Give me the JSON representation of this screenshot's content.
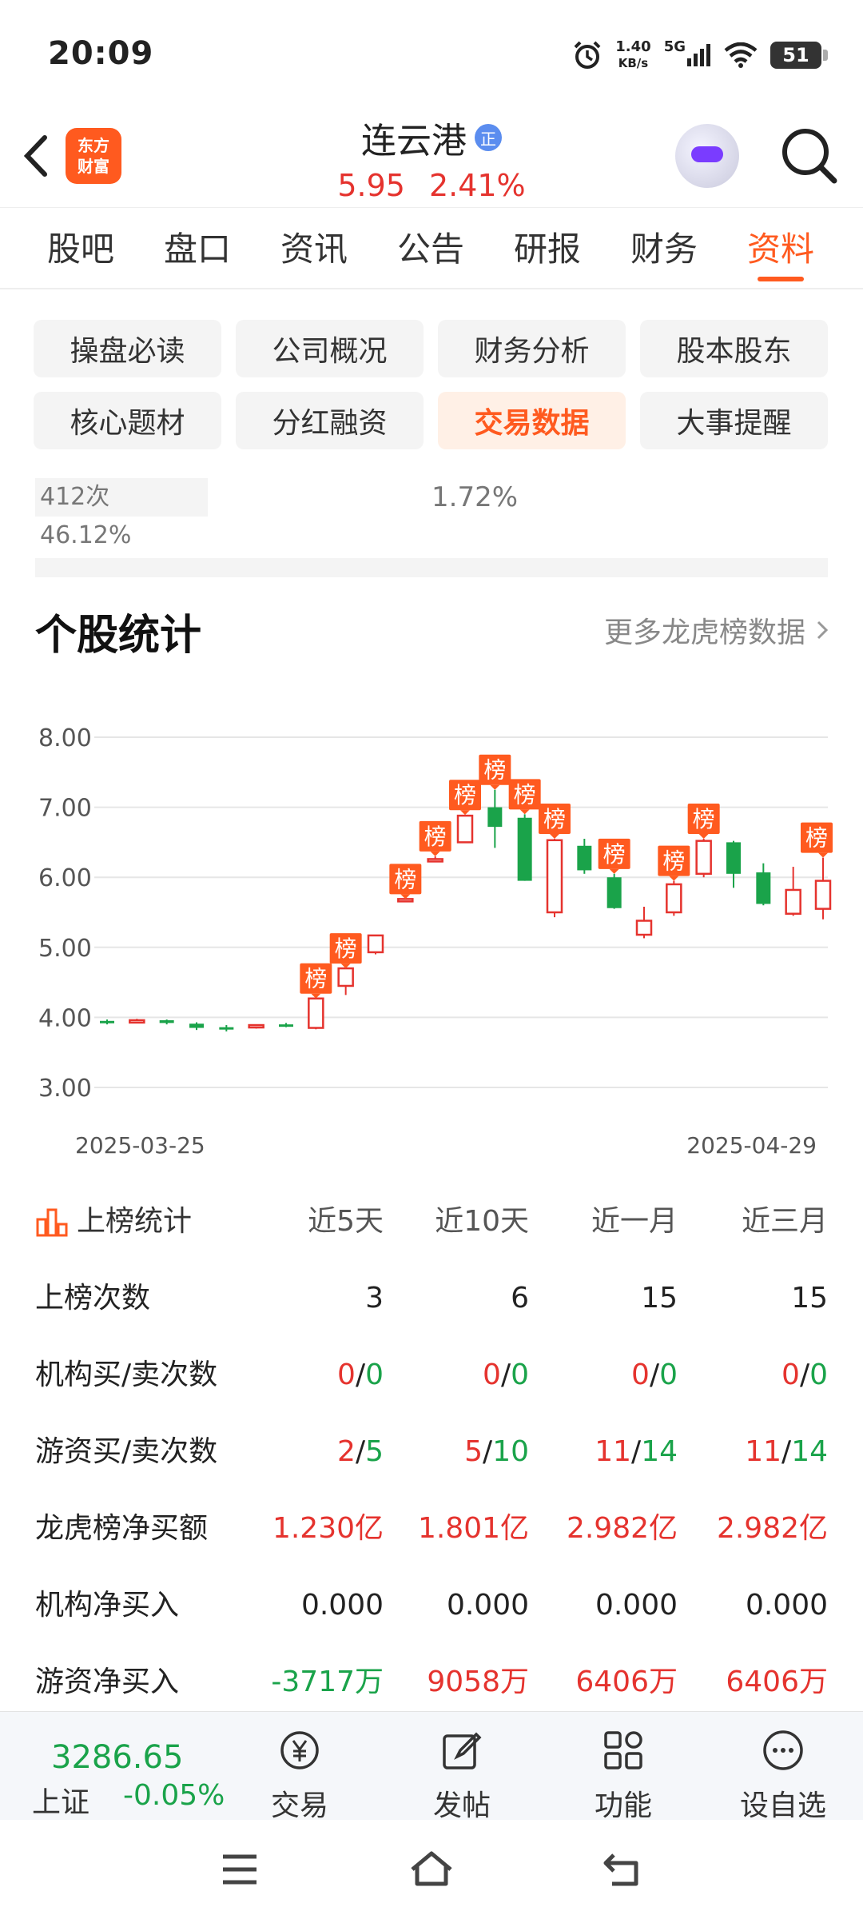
{
  "status_bar": {
    "time": "20:09",
    "net_speed_value": "1.40",
    "net_speed_unit": "KB/s",
    "network": "5G",
    "battery": "51"
  },
  "header": {
    "logo_text_1": "东方",
    "logo_text_2": "财富",
    "stock_name": "连云港",
    "badge": "正",
    "price": "5.95",
    "change_pct": "2.41%"
  },
  "tabs": [
    {
      "label": "股吧"
    },
    {
      "label": "盘口"
    },
    {
      "label": "资讯"
    },
    {
      "label": "公告"
    },
    {
      "label": "研报"
    },
    {
      "label": "财务"
    },
    {
      "label": "资料",
      "active": true
    }
  ],
  "sub_tabs": [
    {
      "label": "操盘必读"
    },
    {
      "label": "公司概况"
    },
    {
      "label": "财务分析"
    },
    {
      "label": "股本股东"
    },
    {
      "label": "核心题材"
    },
    {
      "label": "分红融资"
    },
    {
      "label": "交易数据",
      "active": true
    },
    {
      "label": "大事提醒"
    }
  ],
  "snippet": {
    "left": "412次 46.12%",
    "mid": "1.72%"
  },
  "section": {
    "title": "个股统计",
    "more_link": "更多龙虎榜数据"
  },
  "chart_data": {
    "type": "candlestick",
    "x_start_label": "2025-03-25",
    "x_end_label": "2025-04-29",
    "yticks": [
      "8.00",
      "7.00",
      "6.00",
      "5.00",
      "4.00",
      "3.00"
    ],
    "ylim": [
      3.0,
      8.0
    ],
    "marker_text": "榜",
    "up_color": "#e5332e",
    "down_color": "#1aa34a",
    "marker_color": "#ff5a1f",
    "candles": [
      {
        "o": 3.95,
        "c": 3.92,
        "h": 3.97,
        "l": 3.9,
        "m": false
      },
      {
        "o": 3.94,
        "c": 3.96,
        "h": 3.98,
        "l": 3.92,
        "m": false
      },
      {
        "o": 3.96,
        "c": 3.92,
        "h": 3.97,
        "l": 3.9,
        "m": false
      },
      {
        "o": 3.91,
        "c": 3.85,
        "h": 3.93,
        "l": 3.82,
        "m": false
      },
      {
        "o": 3.86,
        "c": 3.83,
        "h": 3.89,
        "l": 3.8,
        "m": false
      },
      {
        "o": 3.86,
        "c": 3.89,
        "h": 3.9,
        "l": 3.84,
        "m": false
      },
      {
        "o": 3.9,
        "c": 3.88,
        "h": 3.92,
        "l": 3.86,
        "m": false
      },
      {
        "o": 3.85,
        "c": 4.27,
        "h": 4.27,
        "l": 3.83,
        "m": true
      },
      {
        "o": 4.45,
        "c": 4.7,
        "h": 4.7,
        "l": 4.32,
        "m": true
      },
      {
        "o": 4.93,
        "c": 5.17,
        "h": 5.17,
        "l": 4.9,
        "m": false
      },
      {
        "o": 5.69,
        "c": 5.69,
        "h": 5.69,
        "l": 5.65,
        "m": true
      },
      {
        "o": 6.26,
        "c": 6.26,
        "h": 6.3,
        "l": 6.24,
        "m": true
      },
      {
        "o": 6.5,
        "c": 6.88,
        "h": 6.89,
        "l": 6.5,
        "m": true
      },
      {
        "o": 7.0,
        "c": 6.72,
        "h": 7.25,
        "l": 6.42,
        "m": true
      },
      {
        "o": 6.85,
        "c": 5.95,
        "h": 6.9,
        "l": 5.95,
        "m": true
      },
      {
        "o": 5.5,
        "c": 6.53,
        "h": 6.55,
        "l": 5.43,
        "m": true
      },
      {
        "o": 6.45,
        "c": 6.1,
        "h": 6.55,
        "l": 6.05,
        "m": false
      },
      {
        "o": 6.0,
        "c": 5.56,
        "h": 6.05,
        "l": 5.55,
        "m": true
      },
      {
        "o": 5.18,
        "c": 5.38,
        "h": 5.58,
        "l": 5.13,
        "m": false
      },
      {
        "o": 5.5,
        "c": 5.9,
        "h": 5.95,
        "l": 5.45,
        "m": true
      },
      {
        "o": 6.05,
        "c": 6.52,
        "h": 6.55,
        "l": 6.0,
        "m": true
      },
      {
        "o": 6.5,
        "c": 6.05,
        "h": 6.52,
        "l": 5.85,
        "m": false
      },
      {
        "o": 6.07,
        "c": 5.62,
        "h": 6.2,
        "l": 5.6,
        "m": false
      },
      {
        "o": 5.48,
        "c": 5.82,
        "h": 6.15,
        "l": 5.45,
        "m": false
      },
      {
        "o": 5.55,
        "c": 5.95,
        "h": 6.28,
        "l": 5.4,
        "m": true
      }
    ]
  },
  "stats": {
    "header": {
      "label": "上榜统计",
      "cols": [
        "近5天",
        "近10天",
        "近一月",
        "近三月"
      ]
    },
    "rows": [
      {
        "label": "上榜次数",
        "type": "plain",
        "values": [
          "3",
          "6",
          "15",
          "15"
        ]
      },
      {
        "label": "机构买/卖次数",
        "type": "split",
        "values": [
          [
            "0",
            "0"
          ],
          [
            "0",
            "0"
          ],
          [
            "0",
            "0"
          ],
          [
            "0",
            "0"
          ]
        ]
      },
      {
        "label": "游资买/卖次数",
        "type": "split",
        "values": [
          [
            "2",
            "5"
          ],
          [
            "5",
            "10"
          ],
          [
            "11",
            "14"
          ],
          [
            "11",
            "14"
          ]
        ]
      },
      {
        "label": "龙虎榜净买额",
        "type": "colored",
        "values": [
          [
            "1.230亿",
            "red"
          ],
          [
            "1.801亿",
            "red"
          ],
          [
            "2.982亿",
            "red"
          ],
          [
            "2.982亿",
            "red"
          ]
        ]
      },
      {
        "label": "机构净买入",
        "type": "plain",
        "values": [
          "0.000",
          "0.000",
          "0.000",
          "0.000"
        ]
      },
      {
        "label": "游资净买入",
        "type": "colored",
        "values": [
          [
            "-3717万",
            "green"
          ],
          [
            "9058万",
            "red"
          ],
          [
            "6406万",
            "red"
          ],
          [
            "6406万",
            "red"
          ]
        ]
      }
    ]
  },
  "bottom_bar": {
    "index_value": "3286.65",
    "index_name": "上证",
    "index_change": "-0.05%",
    "items": [
      {
        "label": "交易",
        "icon": "yuan-exchange-icon"
      },
      {
        "label": "发帖",
        "icon": "edit-post-icon"
      },
      {
        "label": "功能",
        "icon": "grid-icon"
      },
      {
        "label": "设自选",
        "icon": "more-dots-icon"
      }
    ]
  }
}
